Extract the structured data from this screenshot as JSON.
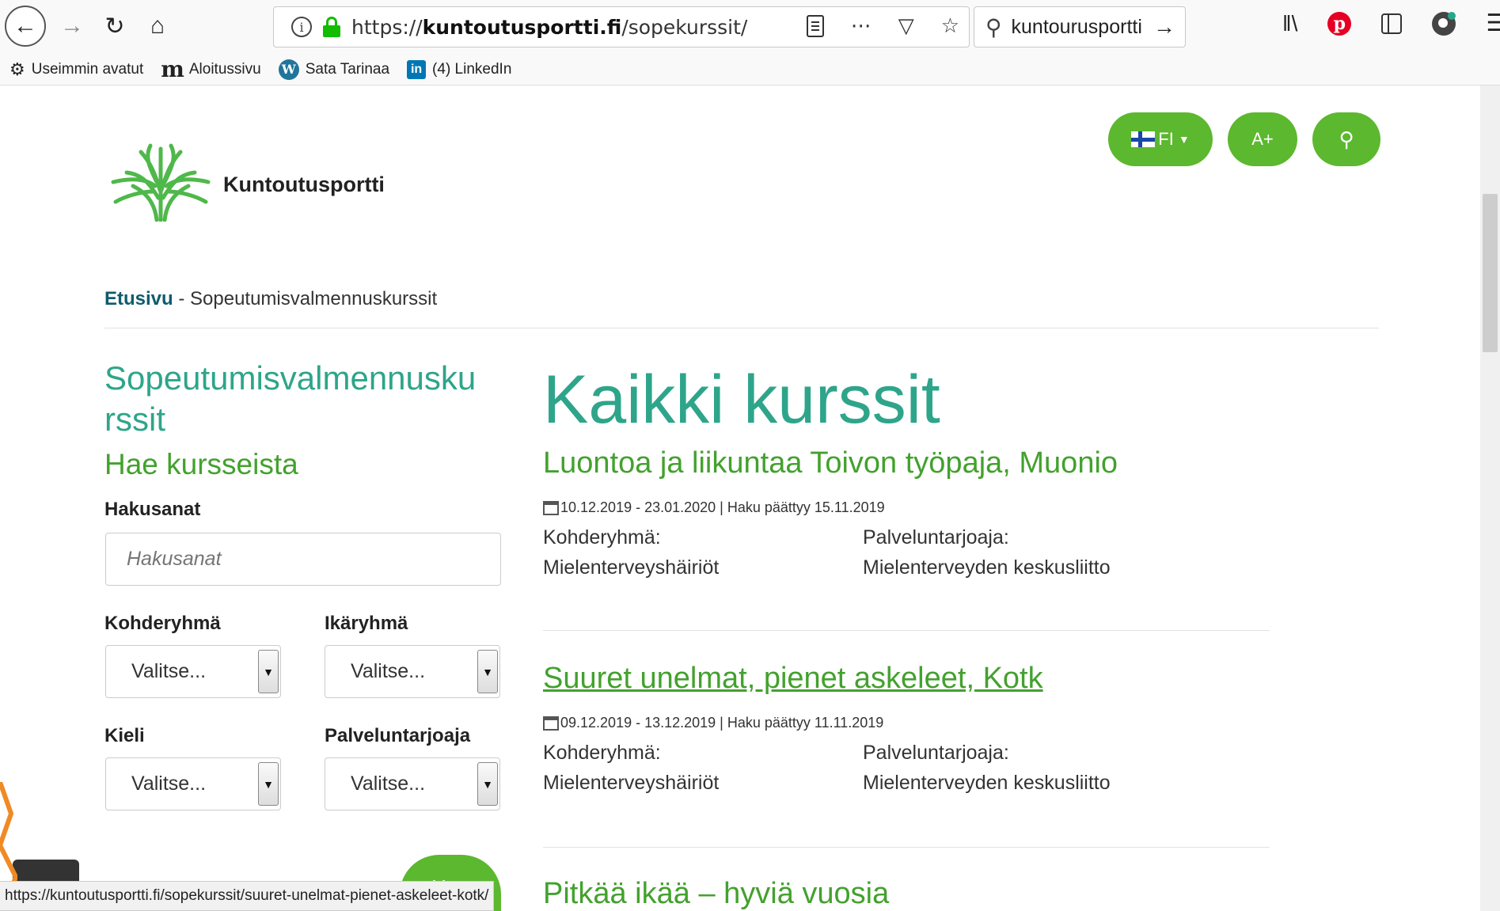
{
  "browser": {
    "url_prefix": "https://",
    "url_host": "kuntoutusportti.fi",
    "url_path": "/sopekurssit/",
    "search_text": "kuntourusportti",
    "bookmarks": [
      {
        "label": "Useimmin avatut",
        "icon": "gear-icon"
      },
      {
        "label": "Aloitussivu",
        "icon": "m-logo-icon"
      },
      {
        "label": "Sata Tarinaa",
        "icon": "wordpress-icon"
      },
      {
        "label": "(4) LinkedIn",
        "icon": "linkedin-icon"
      }
    ],
    "status_url": "https://kuntoutusportti.fi/sopekurssit/suuret-unelmat-pienet-askeleet-kotk/"
  },
  "header": {
    "brand": "Kuntoutusportti",
    "lang_label": "FI",
    "font_size_label": "A+"
  },
  "breadcrumb": {
    "home": "Etusivu",
    "separator": " - ",
    "current": "Sopeutumisvalmennuskurssit"
  },
  "sidebar": {
    "title_line1": "Sopeutumisvalmennusku",
    "title_line2": "rssit",
    "search_heading": "Hae kursseista",
    "keywords_label": "Hakusanat",
    "keywords_placeholder": "Hakusanat",
    "target_group_label": "Kohderyhmä",
    "age_group_label": "Ikäryhmä",
    "language_label": "Kieli",
    "provider_label": "Palveluntarjoaja",
    "select_placeholder": "Valitse...",
    "submit_label": "Hae"
  },
  "main": {
    "title": "Kaikki kurssit",
    "courses": [
      {
        "title": "Luontoa ja liikuntaa Toivon työpaja, Muonio",
        "date": "10.12.2019 - 23.01.2020 | Haku päättyy 15.11.2019",
        "target_label": "Kohderyhmä:",
        "target_value": "Mielenterveyshäiriöt",
        "provider_label": "Palveluntarjoaja:",
        "provider_value": "Mielenterveyden keskusliitto"
      },
      {
        "title": "Suuret unelmat, pienet askeleet, Kotk",
        "date": "09.12.2019 - 13.12.2019 | Haku päättyy 11.11.2019",
        "target_label": "Kohderyhmä:",
        "target_value": "Mielenterveyshäiriöt",
        "provider_label": "Palveluntarjoaja:",
        "provider_value": "Mielenterveyden keskusliitto"
      },
      {
        "title": "Pitkää ikää – hyviä vuosia"
      }
    ]
  },
  "colors": {
    "accent_green": "#5cb82e",
    "heading_teal": "#2ea58a",
    "course_green": "#43a12e",
    "breadcrumb_link": "#0f5b6e"
  }
}
